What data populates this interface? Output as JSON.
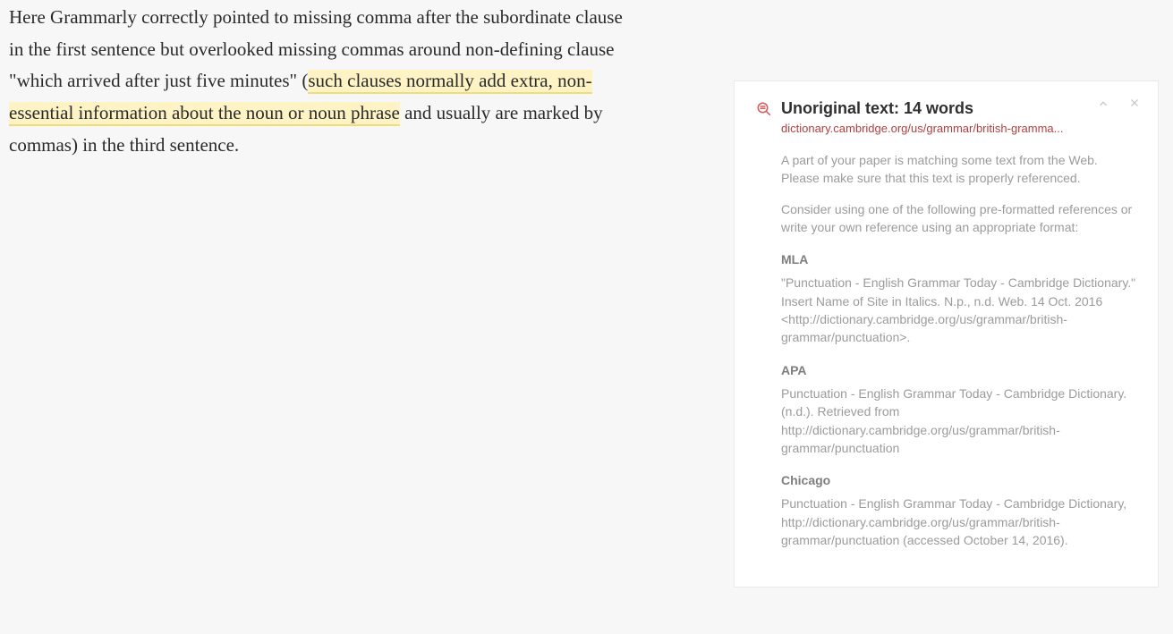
{
  "document": {
    "pre": "Here Grammarly correctly pointed to missing comma after the subordinate clause in the first sentence but overlooked missing commas around non-defining clause \"which arrived after just five minutes\" (",
    "highlighted": "such clauses normally add extra, non-essential information about the noun or noun phrase",
    "post": " and usually are marked by commas) in the third sentence."
  },
  "panel": {
    "title": "Unoriginal text: 14 words",
    "source": "dictionary.cambridge.org/us/grammar/british-gramma...",
    "intro1": "A part of your paper is matching some text from the Web. Please make sure that this text is properly referenced.",
    "intro2": "Consider using one of the following pre-formatted references or write your own reference using an appropriate format:",
    "refs": {
      "mla_label": "MLA",
      "mla_text": "\"Punctuation - English Grammar Today - Cambridge Dictionary.\" Insert Name of Site in Italics. N.p., n.d. Web. 14 Oct. 2016 <http://dictionary.cambridge.org/us/grammar/british-grammar/punctuation>.",
      "apa_label": "APA",
      "apa_text": "Punctuation - English Grammar Today - Cambridge Dictionary. (n.d.). Retrieved from http://dictionary.cambridge.org/us/grammar/british-grammar/punctuation",
      "chicago_label": "Chicago",
      "chicago_text": "Punctuation - English Grammar Today - Cambridge Dictionary, http://dictionary.cambridge.org/us/grammar/british-grammar/punctuation (accessed October 14, 2016)."
    }
  }
}
